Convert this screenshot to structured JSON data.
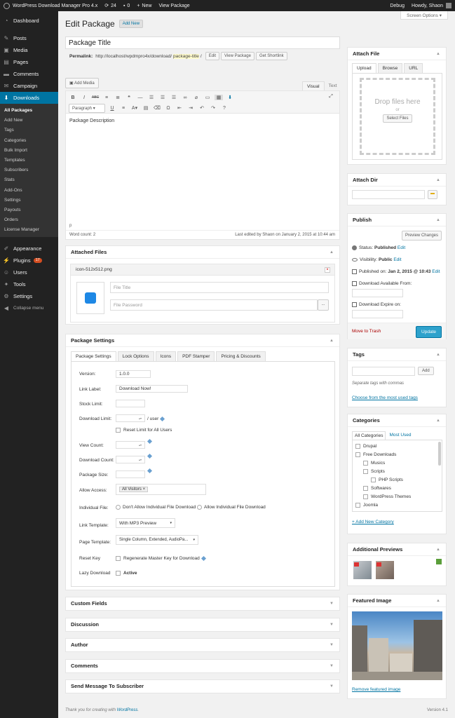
{
  "adminbar": {
    "site": "WordPress Download Manager Pro 4.x",
    "updates": "24",
    "comments": "0",
    "new": "New",
    "view": "View Package",
    "debug": "Debug",
    "howdy": "Howdy, Shaon"
  },
  "menu": {
    "dashboard": "Dashboard",
    "posts": "Posts",
    "media": "Media",
    "pages": "Pages",
    "comments": "Comments",
    "campaign": "Campaign",
    "downloads": "Downloads",
    "sub": [
      "All Packages",
      "Add New",
      "Tags",
      "Categories",
      "Bulk Import",
      "Templates",
      "Subscribers",
      "Stats",
      "Add-Ons",
      "Settings",
      "Payouts",
      "Orders",
      "License Manager"
    ],
    "appearance": "Appearance",
    "plugins": "Plugins",
    "plugins_badge": "17",
    "users": "Users",
    "tools": "Tools",
    "settings": "Settings",
    "collapse": "Collapse menu"
  },
  "header": {
    "title": "Edit Package",
    "add_new": "Add New",
    "screen_options": "Screen Options"
  },
  "post": {
    "title": "Package Title",
    "permalink_label": "Permalink:",
    "permalink_base": "http://localhost/wpdmpro4x/download/",
    "permalink_slug": "package-title",
    "permalink_end": "/",
    "edit": "Edit",
    "view_package": "View Package",
    "get_shortlink": "Get Shortlink",
    "add_media": "Add Media",
    "tab_visual": "Visual",
    "tab_text": "Text",
    "format": "Paragraph",
    "content": "Package Description",
    "path": "p",
    "word_count": "Word count: 2",
    "last_edited": "Last edited by Shaon on January 2, 2015 at 10:44 am"
  },
  "attached": {
    "title": "Attached Files",
    "filename": "icon-512x512.png",
    "file_title_ph": "File Title",
    "file_password_ph": "File Password",
    "more": "..."
  },
  "settings": {
    "title": "Package Settings",
    "tabs": [
      "Package Settings",
      "Lock Options",
      "Icons",
      "PDF Stamper",
      "Pricing & Discounts"
    ],
    "version_label": "Version:",
    "version": "1.0.0",
    "link_label_label": "Link Label:",
    "link_label": "Download Now!",
    "stock_label": "Stock Limit:",
    "dl_limit_label": "Download Limit:",
    "per_user": "/ user",
    "reset_limit": "Reset Limit for All Users",
    "view_count_label": "View Count:",
    "dl_count_label": "Download Count:",
    "size_label": "Package Size:",
    "access_label": "Allow Access:",
    "access_value": "All Visitors ×",
    "indiv_label": "Individual File:",
    "indiv_no": "Don't Allow Individual File Download",
    "indiv_yes": "Allow Individual File Download",
    "link_tpl_label": "Link Template:",
    "link_tpl": "With MP3 Preview",
    "page_tpl_label": "Page Template:",
    "page_tpl": "Single Column, Extended, AudioPa...",
    "reset_key_label": "Reset Key",
    "reset_key": "Regenerate Master Key for Download",
    "lazy_label": "Lazy Download",
    "lazy": "Active"
  },
  "collapsed": [
    "Custom Fields",
    "Discussion",
    "Author",
    "Comments",
    "Send Message To Subscriber"
  ],
  "footer": {
    "thanks": "Thank you for creating with ",
    "wp": "WordPress",
    "end": ".",
    "version": "Version 4.1"
  },
  "attach_file": {
    "title": "Attach File",
    "tabs": [
      "Upload",
      "Browse",
      "URL"
    ],
    "drop": "Drop files here",
    "or": "or",
    "select": "Select Files"
  },
  "attach_dir": {
    "title": "Attach Dir"
  },
  "publish": {
    "title": "Publish",
    "preview": "Preview Changes",
    "status_label": "Status: ",
    "status": "Published",
    "visibility_label": "Visibility: ",
    "visibility": "Public",
    "edit": "Edit",
    "published_label": "Published on: ",
    "published": "Jan 2, 2015 @ 10:43",
    "avail_label": "Download Available From:",
    "expire_label": "Download Expire on:",
    "trash": "Move to Trash",
    "update": "Update"
  },
  "tags": {
    "title": "Tags",
    "add": "Add",
    "hint": "Separate tags with commas",
    "choose": "Choose from the most used tags"
  },
  "categories": {
    "title": "Categories",
    "tab_all": "All Categories",
    "tab_most": "Most Used",
    "items": [
      {
        "label": "Drupal",
        "lvl": 0
      },
      {
        "label": "Free Downloads",
        "lvl": 0
      },
      {
        "label": "Musics",
        "lvl": 1
      },
      {
        "label": "Scripts",
        "lvl": 1
      },
      {
        "label": "PHP Scripts",
        "lvl": 2
      },
      {
        "label": "Softwares",
        "lvl": 1
      },
      {
        "label": "WordPress Themes",
        "lvl": 1
      },
      {
        "label": "Joomla",
        "lvl": 0
      }
    ],
    "add": "+ Add New Category"
  },
  "previews": {
    "title": "Additional Previews"
  },
  "featured": {
    "title": "Featured Image",
    "remove": "Remove featured image"
  },
  "colors": {
    "menu_bg": "#222222",
    "accent": "#0074a2",
    "primary_btn": "#2ea2cc",
    "trash": "#a00000"
  }
}
